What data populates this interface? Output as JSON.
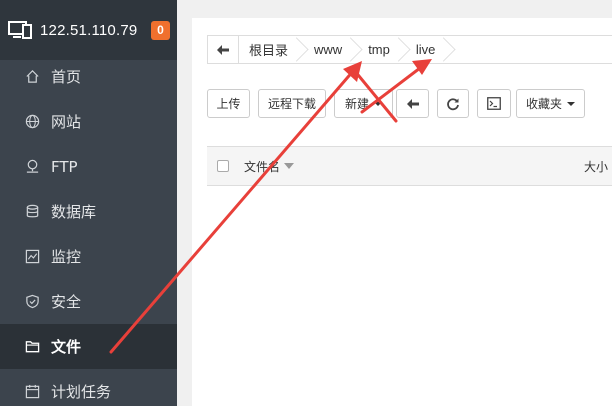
{
  "server": {
    "ip": "122.51.110.79",
    "badge": "0"
  },
  "sidebar": {
    "items": [
      {
        "label": "首页",
        "icon": "home-icon"
      },
      {
        "label": "网站",
        "icon": "globe-icon"
      },
      {
        "label": "FTP",
        "icon": "ftp-icon"
      },
      {
        "label": "数据库",
        "icon": "database-icon"
      },
      {
        "label": "监控",
        "icon": "monitor-chart-icon"
      },
      {
        "label": "安全",
        "icon": "shield-icon"
      },
      {
        "label": "文件",
        "icon": "folder-icon",
        "active": true
      },
      {
        "label": "计划任务",
        "icon": "calendar-icon"
      }
    ]
  },
  "breadcrumb": {
    "root": "根目录",
    "items": [
      "www",
      "tmp",
      "live"
    ]
  },
  "toolbar": {
    "upload": "上传",
    "remote_download": "远程下载",
    "new": "新建",
    "favorites": "收藏夹"
  },
  "table": {
    "col_name": "文件名",
    "col_size": "大小"
  },
  "colors": {
    "accent_arrow": "#e8403a",
    "badge": "#f0702e",
    "sidebar": "#3c444d"
  }
}
